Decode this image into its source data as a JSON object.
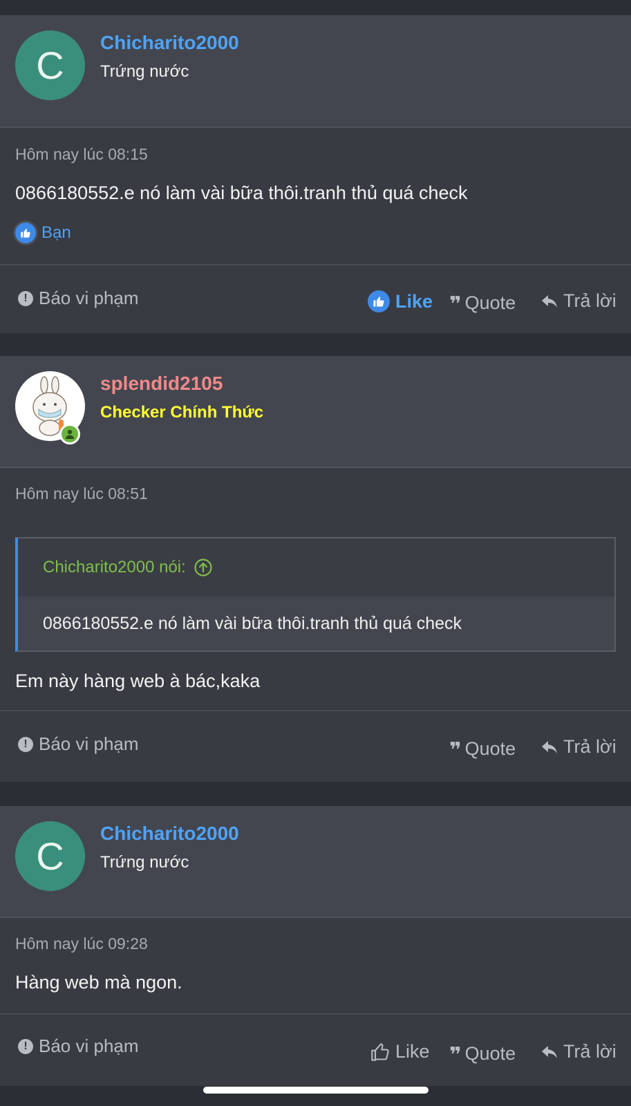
{
  "posts": [
    {
      "avatar_letter": "C",
      "username": "Chicharito2000",
      "usertitle": "Trứng nước",
      "timestamp": "Hôm nay lúc 08:15",
      "message": "0866180552.e nó làm vài bữa thôi.tranh thủ quá check",
      "reaction_label": "Bạn",
      "report_label": "Báo vi phạm",
      "like_label": "Like",
      "quote_label": "Quote",
      "reply_label": "Trả lời"
    },
    {
      "username": "splendid2105",
      "usertitle": "Checker Chính Thức",
      "timestamp": "Hôm nay lúc 08:51",
      "quote_author": "Chicharito2000 nói:",
      "quote_text": "0866180552.e nó làm vài bữa thôi.tranh thủ quá check",
      "message": "Em này hàng web à bác,kaka",
      "report_label": "Báo vi phạm",
      "quote_label": "Quote",
      "reply_label": "Trả lời"
    },
    {
      "avatar_letter": "C",
      "username": "Chicharito2000",
      "usertitle": "Trứng nước",
      "timestamp": "Hôm nay lúc 09:28",
      "message": "Hàng web mà ngon.",
      "report_label": "Báo vi phạm",
      "like_label": "Like",
      "quote_label": "Quote",
      "reply_label": "Trả lời"
    }
  ],
  "colors": {
    "link_blue": "#4fa3f7",
    "moderator_pink": "#f08a8a",
    "checker_yellow": "#ffff33",
    "quote_green": "#7fbf4d",
    "avatar_teal": "#3a8f7c"
  },
  "icons": {
    "report": "exclamation-circle-icon",
    "like": "thumbs-up-icon",
    "quote": "quote-icon",
    "reply": "reply-arrow-icon",
    "jump": "arrow-up-circle-icon",
    "online": "user-online-icon"
  }
}
